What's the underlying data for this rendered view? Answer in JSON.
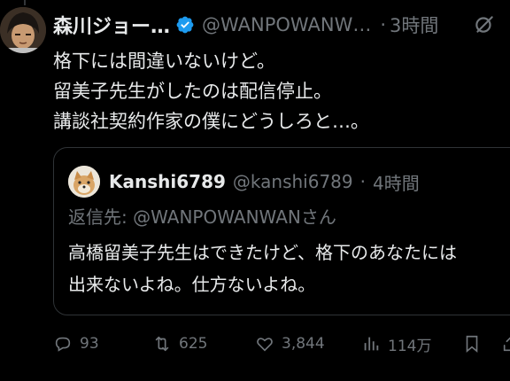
{
  "post": {
    "display_name": "森川ジョー…",
    "handle": "@WANPOWANW…",
    "separator": "·",
    "time": "3時間",
    "lines": [
      "格下には間違いないけど。",
      "留美子先生がしたのは配信停止。",
      "講談社契約作家の僕にどうしろと…。"
    ]
  },
  "quote": {
    "name": "Kanshi6789",
    "handle": "@kanshi6789",
    "separator": "·",
    "time": "4時間",
    "reply_to": "返信先: @WANPOWANWANさん",
    "lines": [
      "高橋留美子先生はできたけど、格下のあなたには",
      "出来ないよね。仕方ないよね。"
    ]
  },
  "actions": {
    "replies": "93",
    "reposts": "625",
    "likes": "3,844",
    "views": "114万"
  },
  "icons": {
    "verified": "verified-badge-icon",
    "grok": "grok-icon",
    "reply": "reply-icon",
    "repost": "repost-icon",
    "like": "like-icon",
    "views": "views-icon",
    "bookmark": "bookmark-icon",
    "share": "share-icon"
  },
  "colors": {
    "background": "#000000",
    "text": "#e7e9ea",
    "muted": "#71767b",
    "verified": "#1d9bf0",
    "border": "#2f3336"
  }
}
